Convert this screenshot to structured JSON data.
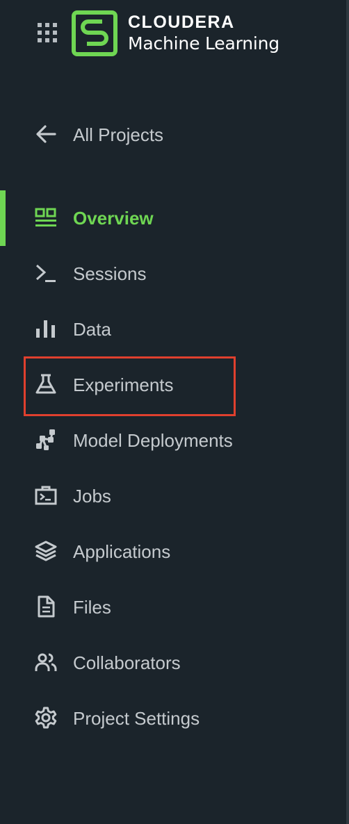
{
  "brand": {
    "top": "CLOUDERA",
    "bottom": "Machine Learning"
  },
  "colors": {
    "background": "#1b242b",
    "text": "#c5cace",
    "accent": "#6fd653",
    "highlight": "#e0402e"
  },
  "back": {
    "label": "All Projects",
    "icon": "arrow-left-icon"
  },
  "nav": [
    {
      "label": "Overview",
      "icon": "overview-icon",
      "active": true
    },
    {
      "label": "Sessions",
      "icon": "terminal-icon"
    },
    {
      "label": "Data",
      "icon": "bar-chart-icon"
    },
    {
      "label": "Experiments",
      "icon": "flask-icon",
      "highlighted": true
    },
    {
      "label": "Model Deployments",
      "icon": "model-network-icon"
    },
    {
      "label": "Jobs",
      "icon": "jobs-icon"
    },
    {
      "label": "Applications",
      "icon": "layers-icon"
    },
    {
      "label": "Files",
      "icon": "file-icon"
    },
    {
      "label": "Collaborators",
      "icon": "people-icon"
    },
    {
      "label": "Project Settings",
      "icon": "gear-icon"
    }
  ]
}
